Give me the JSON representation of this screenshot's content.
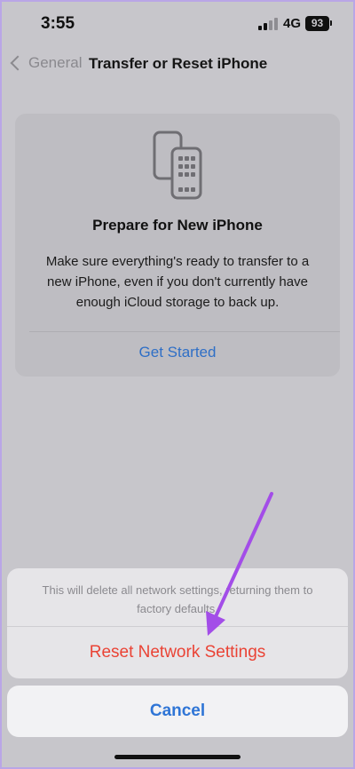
{
  "status_bar": {
    "time": "3:55",
    "network": "4G",
    "battery": "93"
  },
  "nav": {
    "back_label": "General",
    "title": "Transfer or Reset iPhone"
  },
  "card": {
    "icon": "two-phones-icon",
    "title": "Prepare for New iPhone",
    "description": "Make sure everything's ready to transfer to a new iPhone, even if you don't currently have enough iCloud storage to back up.",
    "action_label": "Get Started"
  },
  "action_sheet": {
    "message": "This will delete all network settings, returning them to factory defaults.",
    "destructive_label": "Reset Network Settings",
    "cancel_label": "Cancel"
  },
  "colors": {
    "link": "#2f6fc6",
    "destructive": "#ea4335",
    "annotation_arrow": "#a34de8"
  }
}
